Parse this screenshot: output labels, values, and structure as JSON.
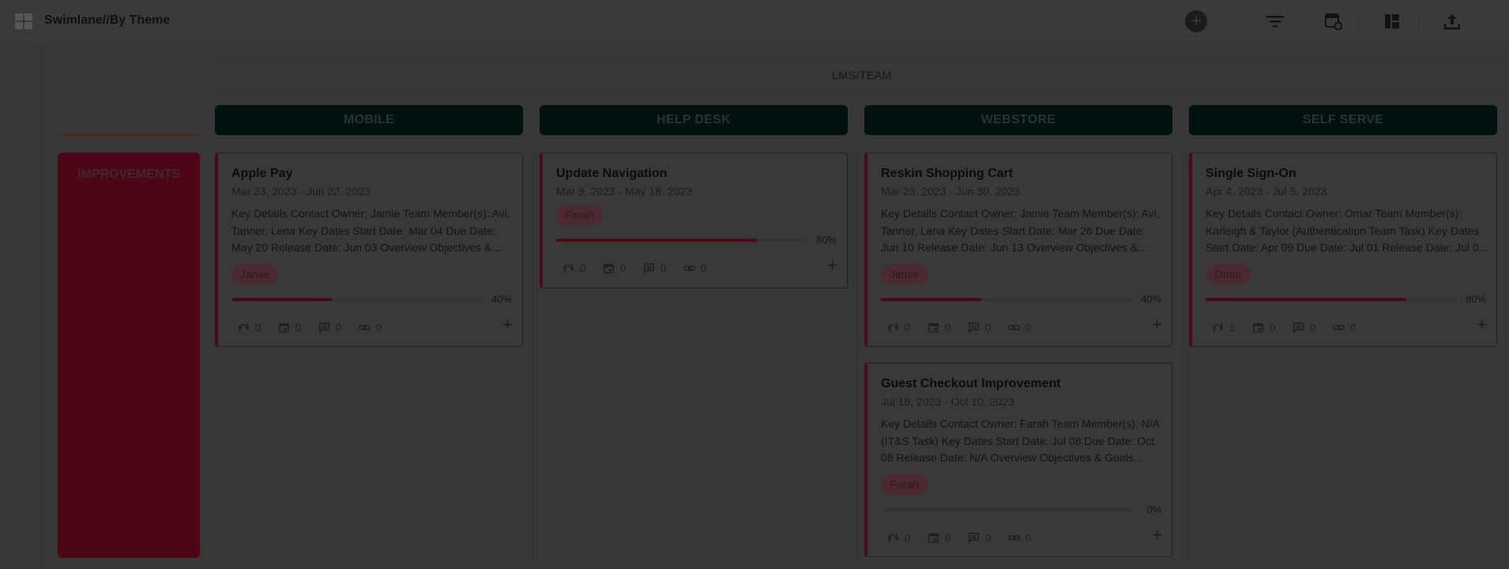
{
  "header": {
    "title": "Swimlane//By Theme"
  },
  "toolbar": {
    "icons": [
      "add-icon",
      "filter-icon",
      "edit-columns-icon",
      "layout-icon",
      "export-icon"
    ]
  },
  "board": {
    "group_label": "LMS/TEAM"
  },
  "columns": [
    {
      "label": "MOBILE"
    },
    {
      "label": "HELP DESK"
    },
    {
      "label": "WEBSTORE"
    },
    {
      "label": "SELF SERVE"
    }
  ],
  "lane": {
    "label": "IMPROVEMENTS"
  },
  "cards": [
    {
      "title": "Apple Pay",
      "dates": "Mar 23, 2023 - Jun 22, 2023",
      "description": "Key Details Contact Owner: Jamie Team Member(s): Avi, Tanner, Lena Key Dates Start Date: Mar 04 Due Date: May 20 Release Date: Jun 03 Overview Objectives & Goals...",
      "assignee": "Jamie",
      "progress": 40,
      "progress_label": "40%",
      "stats": [
        "0",
        "0",
        "0",
        "0"
      ]
    },
    {
      "title": "Update Navigation",
      "dates": "Mar 8, 2023 - May 18, 2023",
      "description": "",
      "assignee": "Farah",
      "progress": 80,
      "progress_label": "80%",
      "stats": [
        "0",
        "0",
        "0",
        "0"
      ]
    },
    {
      "title": "Reskin Shopping Cart",
      "dates": "Mar 23, 2023 - Jun 30, 2023",
      "description": "Key Details Contact Owner: Jamie Team Member(s): Avi, Tanner, Lena Key Dates Start Date: Mar 26 Due Date: Jun 10 Release Date: Jun 13 Overview Objectives & Goals...",
      "assignee": "Jamie",
      "progress": 40,
      "progress_label": "40%",
      "stats": [
        "0",
        "0",
        "0",
        "0"
      ]
    },
    {
      "title": "Single Sign-On",
      "dates": "Apr 4, 2023 - Jul 5, 2023",
      "description": "Key Details Contact Owner: Omar Team Member(s): Karleigh & Taylor (Authentication Team Task) Key Dates Start Date: Apr 09 Due Date: Jul 01 Release Date: Jul 0...",
      "assignee": "Omar",
      "progress": 80,
      "progress_label": "80%",
      "stats": [
        "1",
        "0",
        "0",
        "0"
      ]
    },
    {
      "title": "Guest Checkout Improvement",
      "dates": "Jul 18, 2023 - Oct 10, 2023",
      "description": "Key Details Contact Owner: Farah Team Member(s): N/A (IT&S Task) Key Dates Start Date: Jul 08 Due Date: Oct 08 Release Date: N/A Overview Objectives & Goals...",
      "assignee": "Farah",
      "progress": 0,
      "progress_label": "0%",
      "stats": [
        "0",
        "0",
        "0",
        "0"
      ]
    }
  ],
  "card_plus_symbol": "+"
}
